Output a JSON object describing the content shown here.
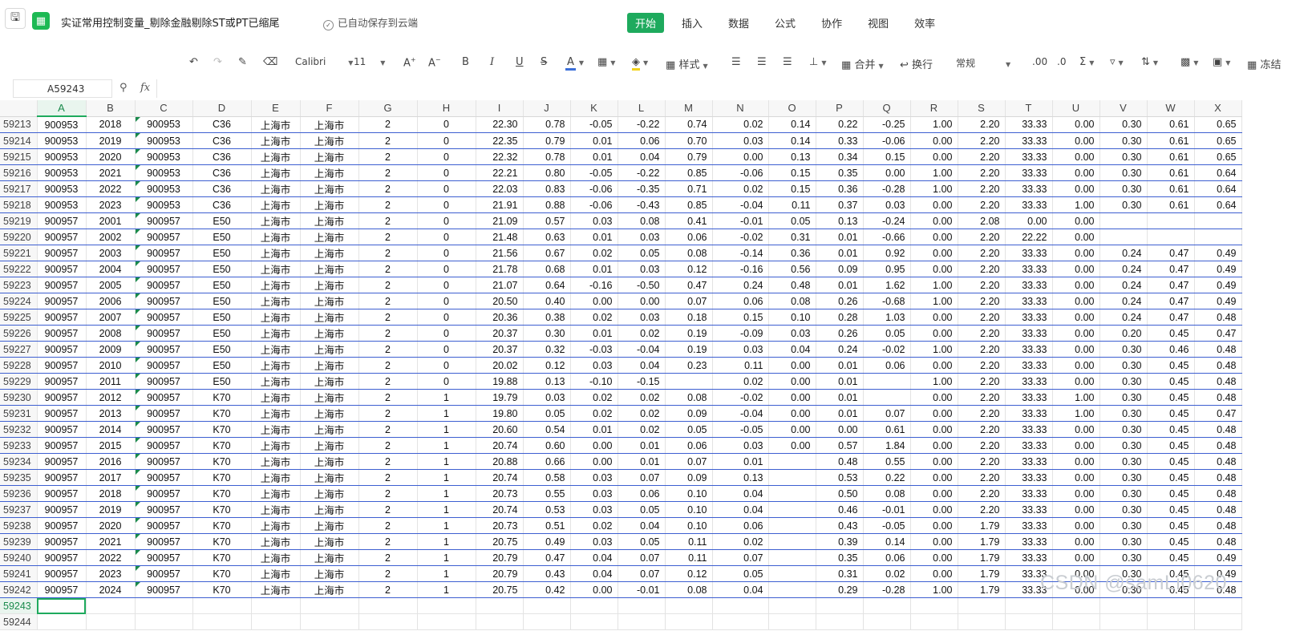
{
  "app": {
    "doc_title": "实证常用控制变量_剔除金融剔除ST或PT已缩尾",
    "autosave_text": "已自动保存到云端",
    "menu": [
      "开始",
      "插入",
      "数据",
      "公式",
      "协作",
      "视图",
      "效率"
    ]
  },
  "toolbar": {
    "font_name": "Calibri",
    "font_size": "11",
    "style_label": "样式",
    "merge_label": "合并",
    "wrap_label": "换行",
    "number_format": "常规",
    "freeze_label": "冻结",
    "underline_color": "#3b6fd9",
    "fill_color": "#f2d21c"
  },
  "formula_bar": {
    "cell_ref": "A59243",
    "fx": "fx",
    "formula": ""
  },
  "sheet": {
    "selected_column": "A",
    "active_row": "59243",
    "columns": [
      "A",
      "B",
      "C",
      "D",
      "E",
      "F",
      "G",
      "H",
      "I",
      "J",
      "K",
      "L",
      "M",
      "N",
      "O",
      "P",
      "Q",
      "R",
      "S",
      "T",
      "U",
      "V",
      "W",
      "X"
    ],
    "rows": [
      {
        "n": "59213",
        "cells": [
          "900953",
          "2018",
          "900953",
          "C36",
          "上海市",
          "上海市",
          "2",
          "0",
          "22.30",
          "0.78",
          "-0.05",
          "-0.22",
          "0.74",
          "0.02",
          "0.14",
          "0.22",
          "-0.25",
          "1.00",
          "2.20",
          "33.33",
          "0.00",
          "0.30",
          "0.61",
          "0.65"
        ]
      },
      {
        "n": "59214",
        "cells": [
          "900953",
          "2019",
          "900953",
          "C36",
          "上海市",
          "上海市",
          "2",
          "0",
          "22.35",
          "0.79",
          "0.01",
          "0.06",
          "0.70",
          "0.03",
          "0.14",
          "0.33",
          "-0.06",
          "0.00",
          "2.20",
          "33.33",
          "0.00",
          "0.30",
          "0.61",
          "0.65"
        ]
      },
      {
        "n": "59215",
        "cells": [
          "900953",
          "2020",
          "900953",
          "C36",
          "上海市",
          "上海市",
          "2",
          "0",
          "22.32",
          "0.78",
          "0.01",
          "0.04",
          "0.79",
          "0.00",
          "0.13",
          "0.34",
          "0.15",
          "0.00",
          "2.20",
          "33.33",
          "0.00",
          "0.30",
          "0.61",
          "0.65"
        ]
      },
      {
        "n": "59216",
        "cells": [
          "900953",
          "2021",
          "900953",
          "C36",
          "上海市",
          "上海市",
          "2",
          "0",
          "22.21",
          "0.80",
          "-0.05",
          "-0.22",
          "0.85",
          "-0.06",
          "0.15",
          "0.35",
          "0.00",
          "1.00",
          "2.20",
          "33.33",
          "0.00",
          "0.30",
          "0.61",
          "0.64"
        ]
      },
      {
        "n": "59217",
        "cells": [
          "900953",
          "2022",
          "900953",
          "C36",
          "上海市",
          "上海市",
          "2",
          "0",
          "22.03",
          "0.83",
          "-0.06",
          "-0.35",
          "0.71",
          "0.02",
          "0.15",
          "0.36",
          "-0.28",
          "1.00",
          "2.20",
          "33.33",
          "0.00",
          "0.30",
          "0.61",
          "0.64"
        ]
      },
      {
        "n": "59218",
        "cells": [
          "900953",
          "2023",
          "900953",
          "C36",
          "上海市",
          "上海市",
          "2",
          "0",
          "21.91",
          "0.88",
          "-0.06",
          "-0.43",
          "0.85",
          "-0.04",
          "0.11",
          "0.37",
          "0.03",
          "0.00",
          "2.20",
          "33.33",
          "1.00",
          "0.30",
          "0.61",
          "0.64"
        ]
      },
      {
        "n": "59219",
        "cells": [
          "900957",
          "2001",
          "900957",
          "E50",
          "上海市",
          "上海市",
          "2",
          "0",
          "21.09",
          "0.57",
          "0.03",
          "0.08",
          "0.41",
          "-0.01",
          "0.05",
          "0.13",
          "-0.24",
          "0.00",
          "2.08",
          "0.00",
          "0.00",
          "",
          "",
          ""
        ]
      },
      {
        "n": "59220",
        "cells": [
          "900957",
          "2002",
          "900957",
          "E50",
          "上海市",
          "上海市",
          "2",
          "0",
          "21.48",
          "0.63",
          "0.01",
          "0.03",
          "0.06",
          "-0.02",
          "0.31",
          "0.01",
          "-0.66",
          "0.00",
          "2.20",
          "22.22",
          "0.00",
          "",
          "",
          ""
        ]
      },
      {
        "n": "59221",
        "cells": [
          "900957",
          "2003",
          "900957",
          "E50",
          "上海市",
          "上海市",
          "2",
          "0",
          "21.56",
          "0.67",
          "0.02",
          "0.05",
          "0.08",
          "-0.14",
          "0.36",
          "0.01",
          "0.92",
          "0.00",
          "2.20",
          "33.33",
          "0.00",
          "0.24",
          "0.47",
          "0.49"
        ]
      },
      {
        "n": "59222",
        "cells": [
          "900957",
          "2004",
          "900957",
          "E50",
          "上海市",
          "上海市",
          "2",
          "0",
          "21.78",
          "0.68",
          "0.01",
          "0.03",
          "0.12",
          "-0.16",
          "0.56",
          "0.09",
          "0.95",
          "0.00",
          "2.20",
          "33.33",
          "0.00",
          "0.24",
          "0.47",
          "0.49"
        ]
      },
      {
        "n": "59223",
        "cells": [
          "900957",
          "2005",
          "900957",
          "E50",
          "上海市",
          "上海市",
          "2",
          "0",
          "21.07",
          "0.64",
          "-0.16",
          "-0.50",
          "0.47",
          "0.24",
          "0.48",
          "0.01",
          "1.62",
          "1.00",
          "2.20",
          "33.33",
          "0.00",
          "0.24",
          "0.47",
          "0.49"
        ]
      },
      {
        "n": "59224",
        "cells": [
          "900957",
          "2006",
          "900957",
          "E50",
          "上海市",
          "上海市",
          "2",
          "0",
          "20.50",
          "0.40",
          "0.00",
          "0.00",
          "0.07",
          "0.06",
          "0.08",
          "0.26",
          "-0.68",
          "1.00",
          "2.20",
          "33.33",
          "0.00",
          "0.24",
          "0.47",
          "0.49"
        ]
      },
      {
        "n": "59225",
        "cells": [
          "900957",
          "2007",
          "900957",
          "E50",
          "上海市",
          "上海市",
          "2",
          "0",
          "20.36",
          "0.38",
          "0.02",
          "0.03",
          "0.18",
          "0.15",
          "0.10",
          "0.28",
          "1.03",
          "0.00",
          "2.20",
          "33.33",
          "0.00",
          "0.24",
          "0.47",
          "0.48"
        ]
      },
      {
        "n": "59226",
        "cells": [
          "900957",
          "2008",
          "900957",
          "E50",
          "上海市",
          "上海市",
          "2",
          "0",
          "20.37",
          "0.30",
          "0.01",
          "0.02",
          "0.19",
          "-0.09",
          "0.03",
          "0.26",
          "0.05",
          "0.00",
          "2.20",
          "33.33",
          "0.00",
          "0.20",
          "0.45",
          "0.47"
        ]
      },
      {
        "n": "59227",
        "cells": [
          "900957",
          "2009",
          "900957",
          "E50",
          "上海市",
          "上海市",
          "2",
          "0",
          "20.37",
          "0.32",
          "-0.03",
          "-0.04",
          "0.19",
          "0.03",
          "0.04",
          "0.24",
          "-0.02",
          "1.00",
          "2.20",
          "33.33",
          "0.00",
          "0.30",
          "0.46",
          "0.48"
        ]
      },
      {
        "n": "59228",
        "cells": [
          "900957",
          "2010",
          "900957",
          "E50",
          "上海市",
          "上海市",
          "2",
          "0",
          "20.02",
          "0.12",
          "0.03",
          "0.04",
          "0.23",
          "0.11",
          "0.00",
          "0.01",
          "0.06",
          "0.00",
          "2.20",
          "33.33",
          "0.00",
          "0.30",
          "0.45",
          "0.48"
        ]
      },
      {
        "n": "59229",
        "cells": [
          "900957",
          "2011",
          "900957",
          "E50",
          "上海市",
          "上海市",
          "2",
          "0",
          "19.88",
          "0.13",
          "-0.10",
          "-0.15",
          "",
          "0.02",
          "0.00",
          "0.01",
          "",
          "1.00",
          "2.20",
          "33.33",
          "0.00",
          "0.30",
          "0.45",
          "0.48"
        ]
      },
      {
        "n": "59230",
        "cells": [
          "900957",
          "2012",
          "900957",
          "K70",
          "上海市",
          "上海市",
          "2",
          "1",
          "19.79",
          "0.03",
          "0.02",
          "0.02",
          "0.08",
          "-0.02",
          "0.00",
          "0.01",
          "",
          "0.00",
          "2.20",
          "33.33",
          "1.00",
          "0.30",
          "0.45",
          "0.48"
        ]
      },
      {
        "n": "59231",
        "cells": [
          "900957",
          "2013",
          "900957",
          "K70",
          "上海市",
          "上海市",
          "2",
          "1",
          "19.80",
          "0.05",
          "0.02",
          "0.02",
          "0.09",
          "-0.04",
          "0.00",
          "0.01",
          "0.07",
          "0.00",
          "2.20",
          "33.33",
          "1.00",
          "0.30",
          "0.45",
          "0.47"
        ]
      },
      {
        "n": "59232",
        "cells": [
          "900957",
          "2014",
          "900957",
          "K70",
          "上海市",
          "上海市",
          "2",
          "1",
          "20.60",
          "0.54",
          "0.01",
          "0.02",
          "0.05",
          "-0.05",
          "0.00",
          "0.00",
          "0.61",
          "0.00",
          "2.20",
          "33.33",
          "0.00",
          "0.30",
          "0.45",
          "0.48"
        ]
      },
      {
        "n": "59233",
        "cells": [
          "900957",
          "2015",
          "900957",
          "K70",
          "上海市",
          "上海市",
          "2",
          "1",
          "20.74",
          "0.60",
          "0.00",
          "0.01",
          "0.06",
          "0.03",
          "0.00",
          "0.57",
          "1.84",
          "0.00",
          "2.20",
          "33.33",
          "0.00",
          "0.30",
          "0.45",
          "0.48"
        ]
      },
      {
        "n": "59234",
        "cells": [
          "900957",
          "2016",
          "900957",
          "K70",
          "上海市",
          "上海市",
          "2",
          "1",
          "20.88",
          "0.66",
          "0.00",
          "0.01",
          "0.07",
          "0.01",
          "",
          "0.48",
          "0.55",
          "0.00",
          "2.20",
          "33.33",
          "0.00",
          "0.30",
          "0.45",
          "0.48"
        ]
      },
      {
        "n": "59235",
        "cells": [
          "900957",
          "2017",
          "900957",
          "K70",
          "上海市",
          "上海市",
          "2",
          "1",
          "20.74",
          "0.58",
          "0.03",
          "0.07",
          "0.09",
          "0.13",
          "",
          "0.53",
          "0.22",
          "0.00",
          "2.20",
          "33.33",
          "0.00",
          "0.30",
          "0.45",
          "0.48"
        ]
      },
      {
        "n": "59236",
        "cells": [
          "900957",
          "2018",
          "900957",
          "K70",
          "上海市",
          "上海市",
          "2",
          "1",
          "20.73",
          "0.55",
          "0.03",
          "0.06",
          "0.10",
          "0.04",
          "",
          "0.50",
          "0.08",
          "0.00",
          "2.20",
          "33.33",
          "0.00",
          "0.30",
          "0.45",
          "0.48"
        ]
      },
      {
        "n": "59237",
        "cells": [
          "900957",
          "2019",
          "900957",
          "K70",
          "上海市",
          "上海市",
          "2",
          "1",
          "20.74",
          "0.53",
          "0.03",
          "0.05",
          "0.10",
          "0.04",
          "",
          "0.46",
          "-0.01",
          "0.00",
          "2.20",
          "33.33",
          "0.00",
          "0.30",
          "0.45",
          "0.48"
        ]
      },
      {
        "n": "59238",
        "cells": [
          "900957",
          "2020",
          "900957",
          "K70",
          "上海市",
          "上海市",
          "2",
          "1",
          "20.73",
          "0.51",
          "0.02",
          "0.04",
          "0.10",
          "0.06",
          "",
          "0.43",
          "-0.05",
          "0.00",
          "1.79",
          "33.33",
          "0.00",
          "0.30",
          "0.45",
          "0.48"
        ]
      },
      {
        "n": "59239",
        "cells": [
          "900957",
          "2021",
          "900957",
          "K70",
          "上海市",
          "上海市",
          "2",
          "1",
          "20.75",
          "0.49",
          "0.03",
          "0.05",
          "0.11",
          "0.02",
          "",
          "0.39",
          "0.14",
          "0.00",
          "1.79",
          "33.33",
          "0.00",
          "0.30",
          "0.45",
          "0.48"
        ]
      },
      {
        "n": "59240",
        "cells": [
          "900957",
          "2022",
          "900957",
          "K70",
          "上海市",
          "上海市",
          "2",
          "1",
          "20.79",
          "0.47",
          "0.04",
          "0.07",
          "0.11",
          "0.07",
          "",
          "0.35",
          "0.06",
          "0.00",
          "1.79",
          "33.33",
          "0.00",
          "0.30",
          "0.45",
          "0.49"
        ]
      },
      {
        "n": "59241",
        "cells": [
          "900957",
          "2023",
          "900957",
          "K70",
          "上海市",
          "上海市",
          "2",
          "1",
          "20.79",
          "0.43",
          "0.04",
          "0.07",
          "0.12",
          "0.05",
          "",
          "0.31",
          "0.02",
          "0.00",
          "1.79",
          "33.33",
          "0.00",
          "0.30",
          "0.45",
          "0.49"
        ]
      },
      {
        "n": "59242",
        "cells": [
          "900957",
          "2024",
          "900957",
          "K70",
          "上海市",
          "上海市",
          "2",
          "1",
          "20.75",
          "0.42",
          "0.00",
          "-0.01",
          "0.08",
          "0.04",
          "",
          "0.29",
          "-0.28",
          "1.00",
          "1.79",
          "33.33",
          "0.00",
          "0.30",
          "0.45",
          "0.48"
        ]
      }
    ],
    "empty_rows": [
      "59243",
      "59244"
    ]
  },
  "watermark": "CSDN @samLi0620"
}
